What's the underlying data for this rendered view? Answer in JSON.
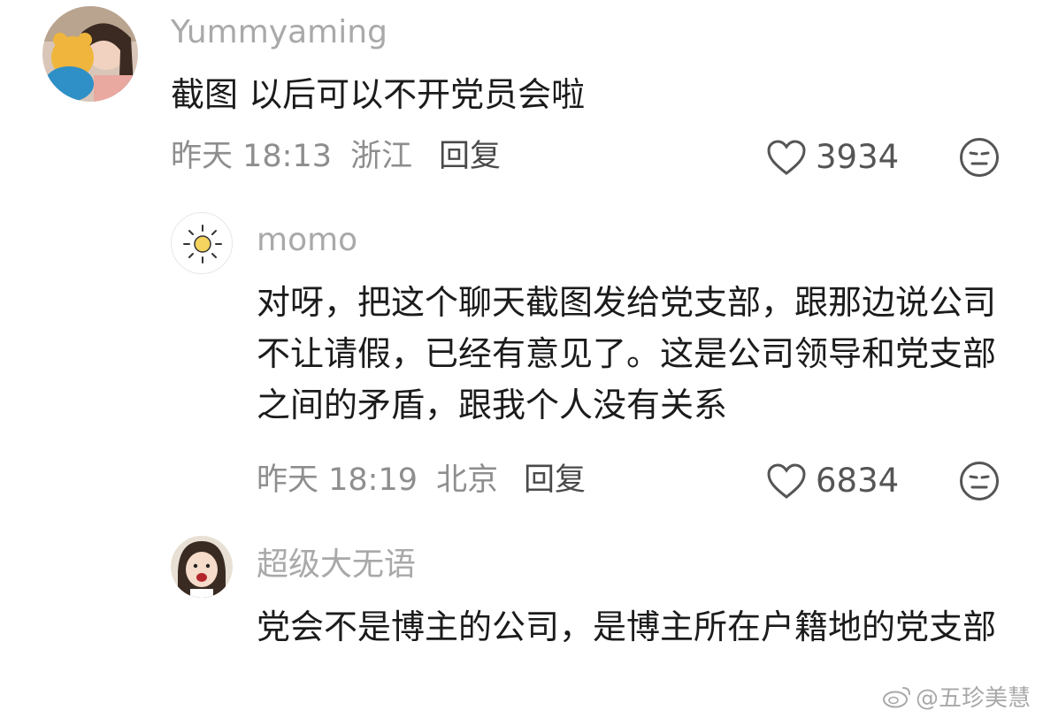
{
  "comments": [
    {
      "username": "Yummyaming",
      "text": "截图 以后可以不开党员会啦",
      "time": "昨天 18:13",
      "location": "浙江",
      "reply_label": "回复",
      "likes": "3934"
    },
    {
      "username": "momo",
      "text": "对呀，把这个聊天截图发给党支部，跟那边说公司不让请假，已经有意见了。这是公司领导和党支部之间的矛盾，跟我个人没有关系",
      "time": "昨天 18:19",
      "location": "北京",
      "reply_label": "回复",
      "likes": "6834"
    },
    {
      "username": "超级大无语",
      "text": "党会不是博主的公司，是博主所在户籍地的党支部"
    }
  ],
  "watermark": {
    "text": "@五珍美慧"
  },
  "colors": {
    "username": "#a9a9a9",
    "meta": "#8e8e8e",
    "body": "#1b1b1b",
    "background": "#ffffff"
  },
  "icons": [
    "heart-icon",
    "dislike-face-icon",
    "weibo-logo-icon"
  ]
}
